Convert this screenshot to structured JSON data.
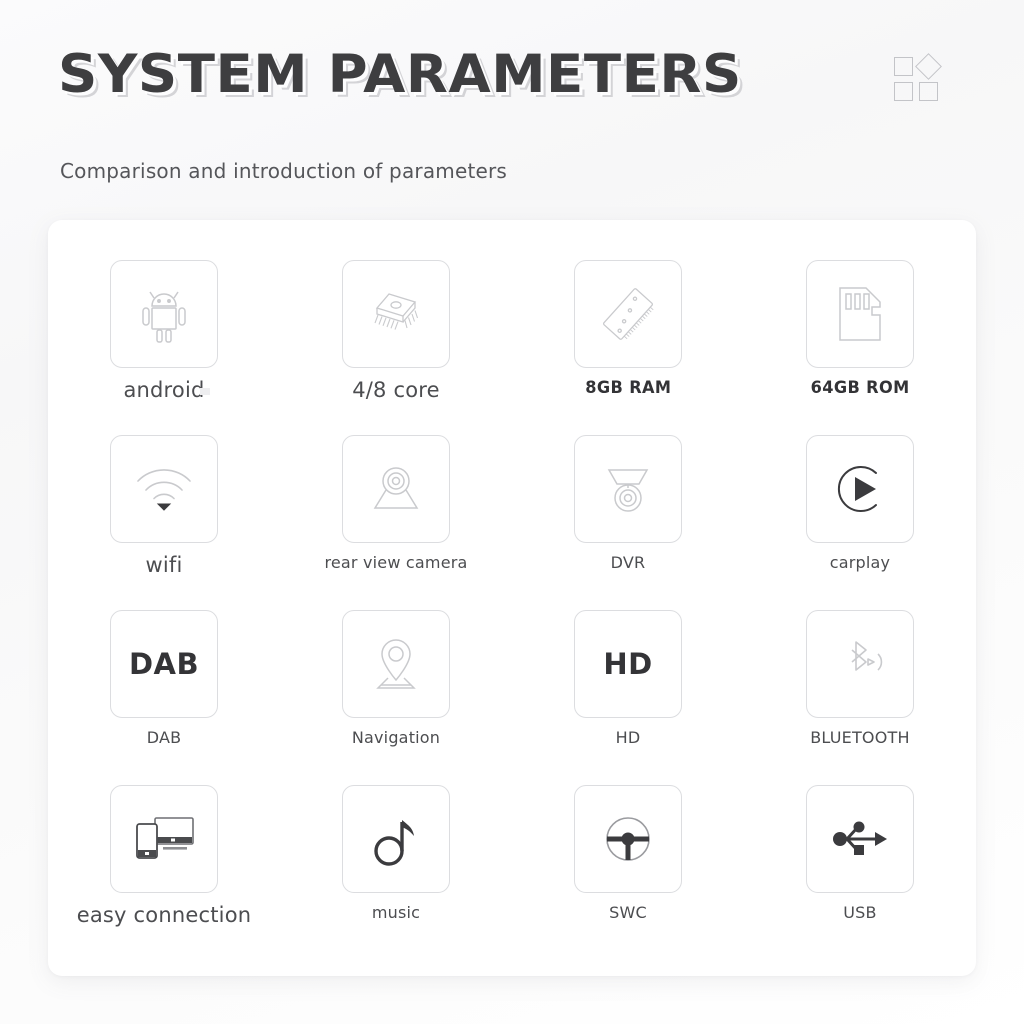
{
  "header": {
    "title": "SYSTEM PARAMETERS",
    "subtitle": "Comparison and introduction of parameters",
    "decoration_icon": "four-squares-mark"
  },
  "colors": {
    "title_text": "#3e3e40",
    "title_shadow": "#cdcdd0",
    "subtitle_text": "#55565a",
    "label_text": "#4c4d50",
    "tile_border": "#dcdde0",
    "card_background": "#ffffff",
    "page_background": "#f7f7f8",
    "icon_stroke": "#c9cacd",
    "icon_dark": "#3b3b3e"
  },
  "grid": {
    "columns": 4,
    "rows": 4,
    "items": [
      {
        "id": "android",
        "label": "android",
        "icon": "android-robot-icon",
        "label_style": "lg",
        "icon_style": "outline"
      },
      {
        "id": "cpu",
        "label": "4/8  core",
        "icon": "cpu-chip-icon",
        "label_style": "lg",
        "icon_style": "outline"
      },
      {
        "id": "ram",
        "label": "8GB  RAM",
        "icon": "ram-stick-icon",
        "label_style": "bold",
        "icon_style": "outline"
      },
      {
        "id": "rom",
        "label": "64GB  ROM",
        "icon": "sd-card-icon",
        "label_style": "bold",
        "icon_style": "outline"
      },
      {
        "id": "wifi",
        "label": "wifi",
        "icon": "wifi-signal-icon",
        "label_style": "lg",
        "icon_style": "outline"
      },
      {
        "id": "rear-camera",
        "label": "rear view camera",
        "icon": "rear-view-camera-icon",
        "label_style": "sm",
        "icon_style": "outline"
      },
      {
        "id": "dvr",
        "label": "DVR",
        "icon": "dvr-camera-icon",
        "label_style": "sm",
        "icon_style": "outline"
      },
      {
        "id": "carplay",
        "label": "carplay",
        "icon": "play-circle-icon",
        "label_style": "sm",
        "icon_style": "dark"
      },
      {
        "id": "dab",
        "label": "DAB",
        "icon": "dab-text-icon",
        "label_style": "sm",
        "icon_style": "text",
        "icon_text": "DAB"
      },
      {
        "id": "navigation",
        "label": "Navigation",
        "icon": "map-pin-icon",
        "label_style": "sm",
        "icon_style": "outline"
      },
      {
        "id": "hd",
        "label": "HD",
        "icon": "hd-text-icon",
        "label_style": "sm",
        "icon_style": "text",
        "icon_text": "HD"
      },
      {
        "id": "bluetooth",
        "label": "BLUETOOTH",
        "icon": "bluetooth-icon",
        "label_style": "sm",
        "icon_style": "outline"
      },
      {
        "id": "easy-connection",
        "label": "easy connection",
        "icon": "screen-mirror-icon",
        "label_style": "lg",
        "icon_style": "dark"
      },
      {
        "id": "music",
        "label": "music",
        "icon": "music-note-icon",
        "label_style": "sm",
        "icon_style": "dark"
      },
      {
        "id": "swc",
        "label": "SWC",
        "icon": "steering-wheel-icon",
        "label_style": "sm",
        "icon_style": "dark"
      },
      {
        "id": "usb",
        "label": "USB",
        "icon": "usb-icon",
        "label_style": "sm",
        "icon_style": "dark"
      }
    ]
  }
}
